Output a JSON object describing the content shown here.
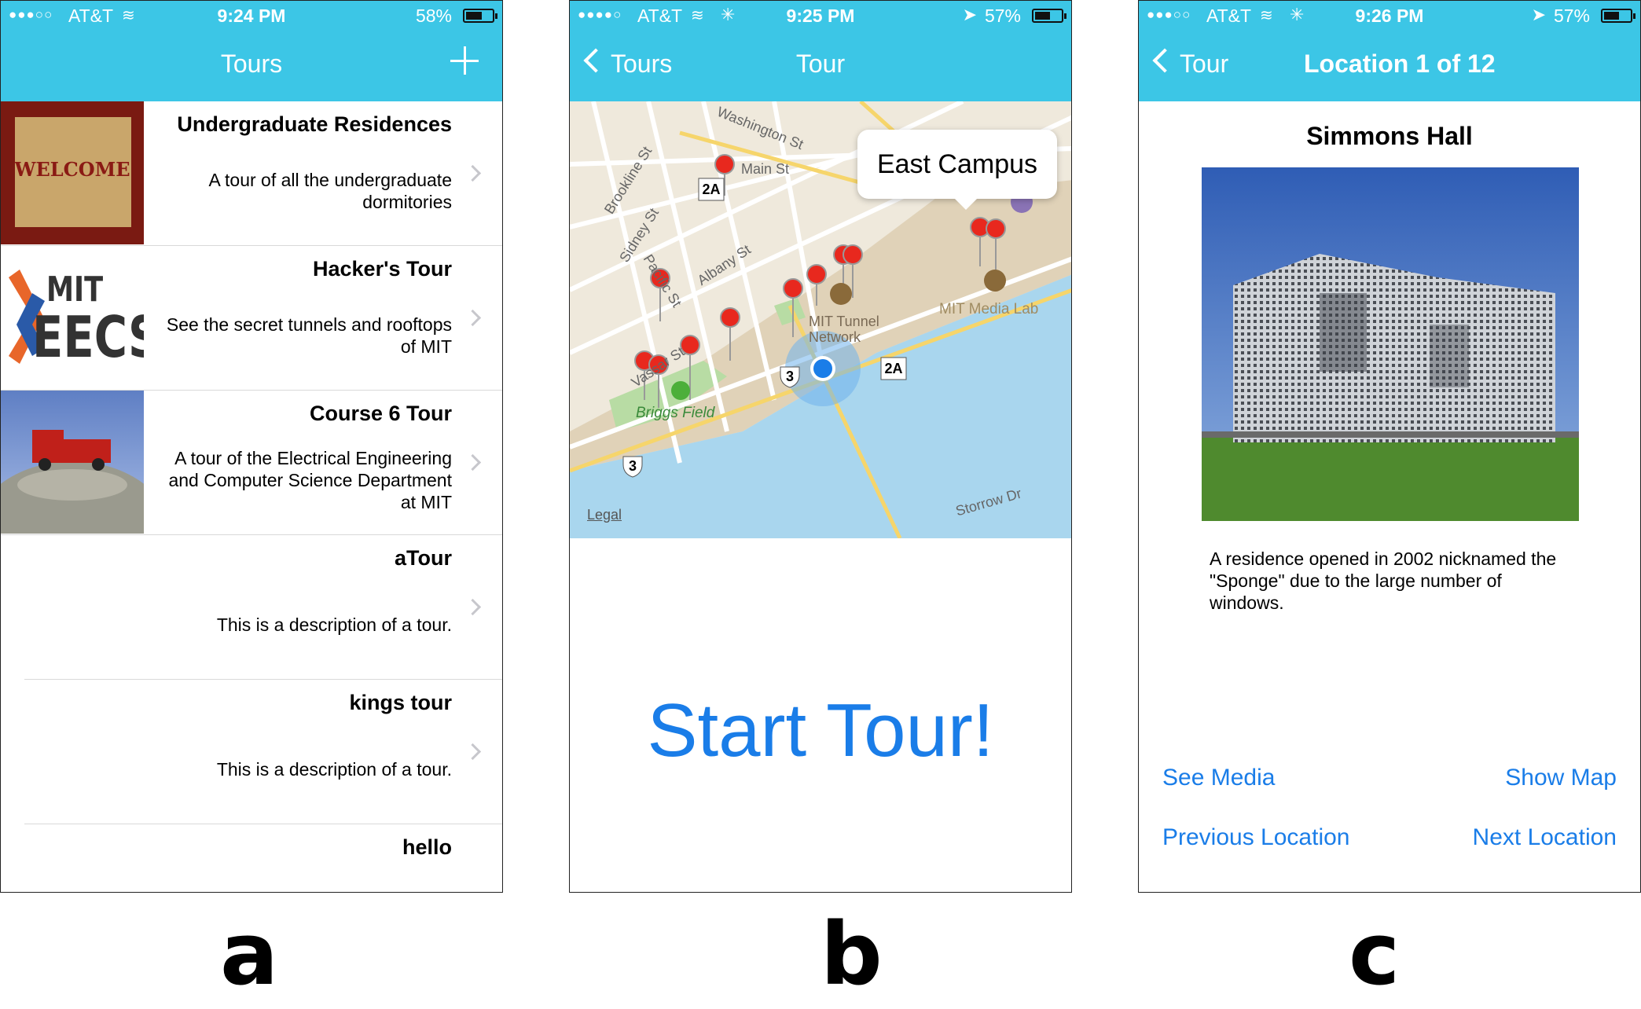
{
  "panels": {
    "a": {
      "label": "a",
      "status": {
        "carrier": "AT&T",
        "time": "9:24 PM",
        "battery": "58%",
        "battery_level": 0.58
      },
      "nav": {
        "title": "Tours"
      },
      "tours": [
        {
          "title": "Undergraduate Residences",
          "description": "A tour of all the undergraduate dormitories",
          "thumb_text": "WELCOME"
        },
        {
          "title": "Hacker's Tour",
          "description": "See the secret tunnels and rooftops of MIT",
          "thumb_text": "MIT EECS"
        },
        {
          "title": "Course 6 Tour",
          "description": "A tour of the Electrical Engineering and Computer Science Department at MIT"
        },
        {
          "title": "aTour",
          "description": "This is a description of a tour."
        },
        {
          "title": "kings tour",
          "description": "This is a description of a tour."
        },
        {
          "title": "hello",
          "description": ""
        }
      ]
    },
    "b": {
      "label": "b",
      "status": {
        "carrier": "AT&T",
        "time": "9:25 PM",
        "battery": "57%",
        "battery_level": 0.57
      },
      "nav": {
        "back": "Tours",
        "title": "Tour"
      },
      "map": {
        "callout": "East Campus",
        "legal": "Legal",
        "streets": [
          "Washington St",
          "Main St",
          "Brookline St",
          "Sidney St",
          "Pacific St",
          "Albany St",
          "Vassar St",
          "Storrow Dr"
        ],
        "places": [
          "MIT Tunnel Network",
          "MIT Media Lab",
          "Briggs Field"
        ],
        "route_shields": [
          "2A",
          "3",
          "3",
          "2A"
        ]
      },
      "start_label": "Start Tour!"
    },
    "c": {
      "label": "c",
      "status": {
        "carrier": "AT&T",
        "time": "9:26 PM",
        "battery": "57%",
        "battery_level": 0.57
      },
      "nav": {
        "back": "Tour",
        "title": "Location 1 of 12"
      },
      "location": {
        "name": "Simmons Hall",
        "description": "A residence opened in 2002 nicknamed the \"Sponge\" due to the large number of windows."
      },
      "actions": {
        "see_media": "See Media",
        "show_map": "Show Map",
        "previous": "Previous Location",
        "next": "Next Location"
      }
    }
  }
}
